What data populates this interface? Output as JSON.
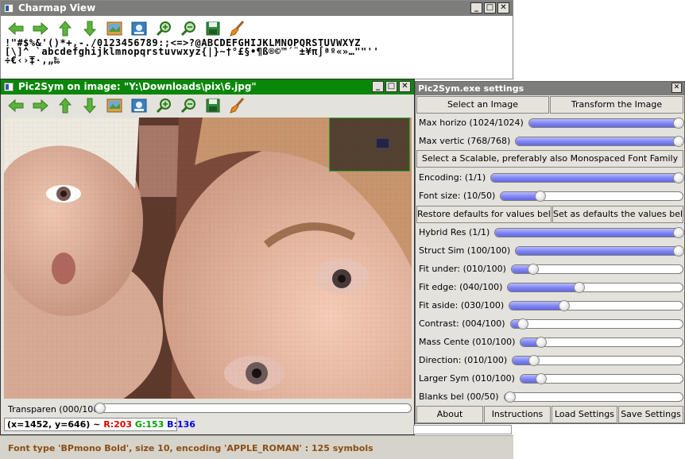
{
  "charmap": {
    "title": "Charmap View",
    "rows": [
      "!\"#$%&'()*+,-./0123456789:;<=>?@ABCDEFGHIJKLMNOPQRSTUVWXYZ",
      "[\\]^_`abcdefghijklmnopqrstuvwxyz{|}~†°£§•¶ß®©™´¨±¥π∫ªº«»…\"\"''",
      "÷€‹›‡·‚„‰"
    ]
  },
  "pic2sym": {
    "title": "Pic2Sym on image: \"Y:\\Downloads\\pix\\6.jpg\"",
    "transparency_label": "Transparen (000/100)",
    "transparency_value": 0,
    "coords": "(x=1452, y=646) ~",
    "r": "R:203",
    "g": "G:153",
    "b": "B:136",
    "status": "Font type 'BPmono Bold', size 10, encoding 'APPLE_ROMAN' : 125 symbols"
  },
  "settings": {
    "title": "Pic2Sym.exe settings",
    "select_image": "Select an Image",
    "transform_image": "Transform the Image",
    "select_font": "Select a Scalable, preferably also Monospaced Font Family",
    "restore_defaults": "Restore defaults for values below",
    "set_defaults": "Set as defaults the values below",
    "about": "About",
    "instructions": "Instructions",
    "load_settings": "Load Settings",
    "save_settings": "Save Settings",
    "sliders": [
      {
        "label": "Max horizo (1024/1024)",
        "value": 1.0
      },
      {
        "label": "Max vertic (768/768)",
        "value": 1.0
      },
      {
        "label": "Encoding:  (1/1)",
        "value": 1.0
      },
      {
        "label": "Font size:  (10/50)",
        "value": 0.2
      },
      {
        "label": "Hybrid Res (1/1)",
        "value": 1.0
      },
      {
        "label": "Struct Sim (100/100)",
        "value": 1.0
      },
      {
        "label": "Fit under:  (010/100)",
        "value": 0.1
      },
      {
        "label": "Fit edge:  (040/100)",
        "value": 0.4
      },
      {
        "label": "Fit aside:  (030/100)",
        "value": 0.3
      },
      {
        "label": "Contrast:  (004/100)",
        "value": 0.04
      },
      {
        "label": "Mass Cente (010/100)",
        "value": 0.1
      },
      {
        "label": "Direction:  (010/100)",
        "value": 0.1
      },
      {
        "label": "Larger Sym (010/100)",
        "value": 0.1
      },
      {
        "label": "Blanks bel (00/50)",
        "value": 0.0
      }
    ]
  },
  "icons": [
    "arrow-left-icon",
    "arrow-right-icon",
    "arrow-up-icon",
    "arrow-down-icon",
    "image-icon",
    "photo-icon",
    "zoom-in-icon",
    "zoom-out-icon",
    "save-icon",
    "brush-icon"
  ]
}
